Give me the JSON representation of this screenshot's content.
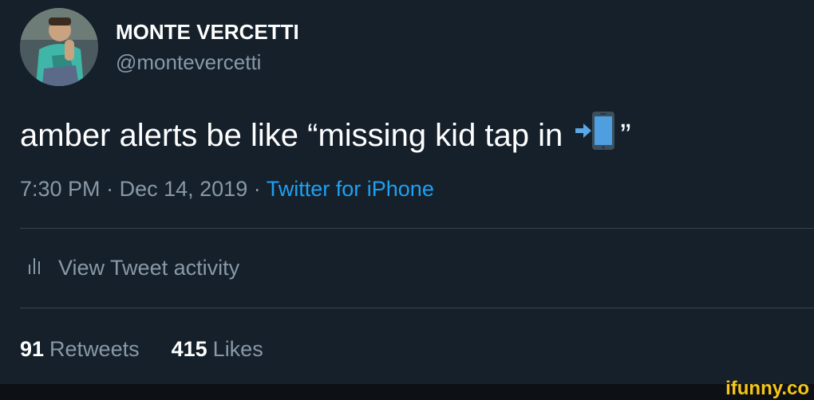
{
  "author": {
    "display_name": "MONTE VERCETTI",
    "handle": "@montevercetti"
  },
  "tweet": {
    "text_before_emoji": "amber alerts be like “missing kid tap in",
    "emoji_icon": "arrow-into-phone-icon",
    "text_after_emoji": "”"
  },
  "meta": {
    "time": "7:30 PM",
    "separator": "·",
    "date": "Dec 14, 2019",
    "source": "Twitter for iPhone"
  },
  "activity": {
    "icon": "bar-chart-icon",
    "label": "View Tweet activity"
  },
  "stats": {
    "retweets_count": "91",
    "retweets_label": "Retweets",
    "likes_count": "415",
    "likes_label": "Likes"
  },
  "watermark": {
    "text": "ifunny.co"
  },
  "colors": {
    "background": "#15202b",
    "primary_text": "#ffffff",
    "secondary_text": "#8899a6",
    "link": "#1da1f2",
    "divider": "#38444d",
    "watermark": "#f5c518"
  }
}
